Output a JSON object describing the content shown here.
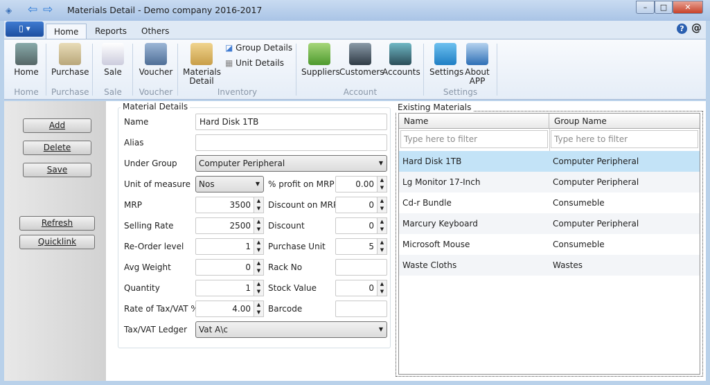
{
  "window": {
    "title": "Materials Detail - Demo company 2016-2017",
    "minimize": "–",
    "maximize": "□",
    "close": "✕"
  },
  "tabs": [
    {
      "label": "Home"
    },
    {
      "label": "Reports"
    },
    {
      "label": "Others"
    }
  ],
  "help": {
    "help": "?",
    "about": "@"
  },
  "ribbon": {
    "buttons": {
      "home": "Home",
      "purchase": "Purchase",
      "sale": "Sale",
      "voucher": "Voucher",
      "materials": "Materials Detail",
      "group_details": "Group Details",
      "unit_details": "Unit Details",
      "suppliers": "Suppliers",
      "customers": "Customers",
      "accounts": "Accounts",
      "settings": "Settings",
      "about": "About APP"
    },
    "groups": {
      "home": "Home",
      "purchase": "Purchase",
      "sale": "Sale",
      "voucher": "Voucher",
      "inventory": "Inventory",
      "account": "Account",
      "settings": "Settings"
    }
  },
  "actions": {
    "add": "Add",
    "delete": "Delete",
    "save": "Save",
    "refresh": "Refresh",
    "quicklink": "Quicklink"
  },
  "form": {
    "title": "Material Details",
    "name_label": "Name",
    "name": "Hard Disk 1TB",
    "alias_label": "Alias",
    "alias": "",
    "group_label": "Under Group",
    "group": "Computer Peripheral",
    "unit_label": "Unit of measure",
    "unit": "Nos",
    "profit_label": "% profit on MRP",
    "profit": "0.00",
    "mrp_label": "MRP",
    "mrp": "3500",
    "disc_mrp_label": "Discount on MRP",
    "disc_mrp": "0",
    "selling_label": "Selling Rate",
    "selling": "2500",
    "discount_label": "Discount",
    "discount": "0",
    "reorder_label": "Re-Order level",
    "reorder": "1",
    "punit_label": "Purchase Unit",
    "punit": "5",
    "weight_label": "Avg Weight",
    "weight": "0",
    "rack_label": "Rack No",
    "rack": "",
    "qty_label": "Quantity",
    "qty": "1",
    "stock_label": "Stock Value",
    "stock": "0",
    "tax_label": "Rate of Tax/VAT %",
    "tax": "4.00",
    "barcode_label": "Barcode",
    "barcode": "",
    "ledger_label": "Tax/VAT Ledger",
    "ledger": "Vat A\\c"
  },
  "materials": {
    "title": "Existing Materials",
    "col_name": "Name",
    "col_group": "Group Name",
    "filter_placeholder": "Type here to filter",
    "rows": [
      {
        "name": "Hard Disk 1TB",
        "group": "Computer Peripheral"
      },
      {
        "name": "Lg Monitor 17-Inch",
        "group": "Computer Peripheral"
      },
      {
        "name": "Cd-r Bundle",
        "group": "Consumeble"
      },
      {
        "name": "Marcury Keyboard",
        "group": "Computer Peripheral"
      },
      {
        "name": "Microsoft Mouse",
        "group": "Consumeble"
      },
      {
        "name": "Waste Cloths",
        "group": "Wastes"
      }
    ]
  }
}
